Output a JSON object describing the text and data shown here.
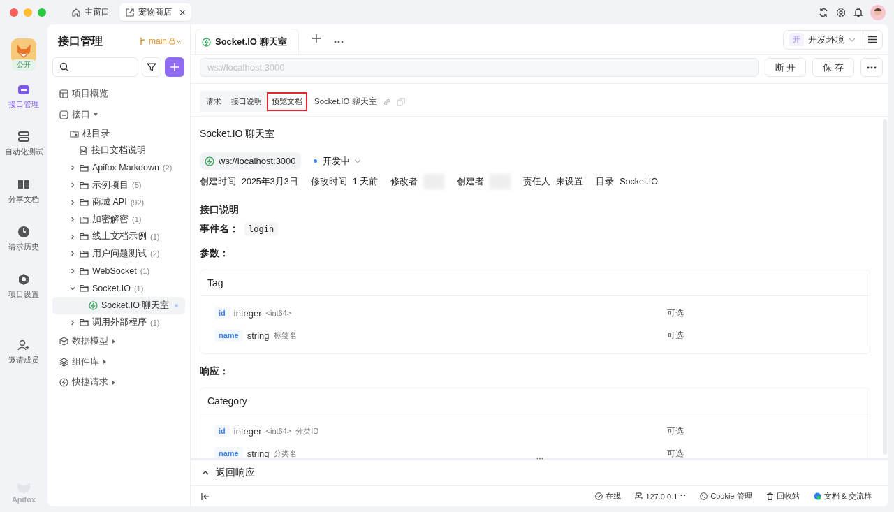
{
  "window": {
    "tabs": [
      {
        "label": "主窗口",
        "kind": "home",
        "selected": false
      },
      {
        "label": "宠物商店",
        "kind": "project",
        "selected": true,
        "closable": "×"
      }
    ]
  },
  "rail": {
    "badge": "公开",
    "items": [
      {
        "label": "接口管理",
        "kind": "api",
        "selected": true
      },
      {
        "label": "自动化测试",
        "kind": "autotest",
        "selected": false
      },
      {
        "label": "分享文档",
        "kind": "share",
        "selected": false
      },
      {
        "label": "请求历史",
        "kind": "history",
        "selected": false
      },
      {
        "label": "项目设置",
        "kind": "settings",
        "selected": false
      },
      {
        "label": "邀请成员",
        "kind": "invite",
        "selected": false
      }
    ],
    "brand": "Apifox"
  },
  "sidebar": {
    "title": "接口管理",
    "branch": "main",
    "nav": [
      {
        "label": "项目概览",
        "kind": "overview"
      },
      {
        "label": "接口",
        "kind": "api",
        "expanded": true,
        "children": [
          {
            "label": "根目录",
            "kind": "root",
            "children": [
              {
                "label": "接口文档说明",
                "kind": "doc"
              }
            ]
          },
          {
            "label": "Apifox Markdown",
            "count": "(2)",
            "kind": "folder",
            "expanded": false
          },
          {
            "label": "示例项目",
            "count": "(5)",
            "kind": "folder",
            "expanded": false
          },
          {
            "label": "商城 API",
            "count": "(92)",
            "kind": "folder",
            "expanded": false
          },
          {
            "label": "加密解密",
            "count": "(1)",
            "kind": "folder",
            "expanded": false
          },
          {
            "label": "线上文档示例",
            "count": "(1)",
            "kind": "folder",
            "expanded": false
          },
          {
            "label": "用户问题测试",
            "count": "(2)",
            "kind": "folder",
            "expanded": false
          },
          {
            "label": "WebSocket",
            "count": "(1)",
            "kind": "folder",
            "expanded": false
          },
          {
            "label": "Socket.IO",
            "count": "(1)",
            "kind": "folder",
            "expanded": true,
            "children": [
              {
                "label": "Socket.IO 聊天室",
                "kind": "socket",
                "selected": true
              }
            ]
          },
          {
            "label": "调用外部程序",
            "count": "(1)",
            "kind": "folder",
            "expanded": false
          }
        ]
      },
      {
        "label": "数据模型",
        "kind": "models",
        "expanded": false
      },
      {
        "label": "组件库",
        "kind": "components",
        "expanded": false
      },
      {
        "label": "快捷请求",
        "kind": "quick",
        "expanded": false
      }
    ]
  },
  "editor_tabs": [
    {
      "label": "Socket.IO 聊天室",
      "selected": true
    }
  ],
  "environment": {
    "badge": "开",
    "label": "开发环境"
  },
  "url_field": {
    "placeholder": "ws://localhost:3000"
  },
  "buttons": [
    {
      "label": "断 开"
    },
    {
      "label": "保 存"
    }
  ],
  "view_tabs": [
    {
      "label": "请求",
      "selected": false
    },
    {
      "label": "接口说明",
      "selected": false
    },
    {
      "label": "预览文档",
      "selected": true
    }
  ],
  "breadcrumb": "Socket.IO 聊天室",
  "doc": {
    "title": "Socket.IO 聊天室",
    "url": "ws://localhost:3000",
    "status": {
      "label": "开发中",
      "color": "#3b82f6"
    },
    "meta": [
      {
        "label": "创建时间",
        "value": "2025年3月3日"
      },
      {
        "label": "修改时间",
        "value": "1 天前"
      },
      {
        "label": "修改者",
        "redacted": true
      },
      {
        "label": "创建者",
        "redacted": true
      },
      {
        "label": "责任人",
        "value": "未设置"
      },
      {
        "label": "目录",
        "value": "Socket.IO"
      }
    ],
    "section": "接口说明",
    "event_label": "事件名：",
    "event": "login",
    "params_label": "参数：",
    "params": {
      "name": "Tag",
      "fields": [
        {
          "name": "id",
          "type": "integer",
          "format": "<int64>",
          "required": "可选"
        },
        {
          "name": "name",
          "type": "string",
          "desc": "标签名",
          "required": "可选"
        }
      ]
    },
    "response_label": "响应：",
    "response": {
      "name": "Category",
      "fields": [
        {
          "name": "id",
          "type": "integer",
          "format": "<int64>",
          "desc": "分类ID",
          "required": "可选"
        },
        {
          "name": "name",
          "type": "string",
          "desc": "分类名",
          "required": "可选"
        }
      ]
    }
  },
  "response_panel": {
    "title": "返回响应",
    "expanded": false
  },
  "status_bar": [
    {
      "label": "在线",
      "kind": "online"
    },
    {
      "label": "127.0.0.1",
      "kind": "proxy"
    },
    {
      "label": "Cookie 管理",
      "kind": "cookie"
    },
    {
      "label": "回收站",
      "kind": "trash"
    },
    {
      "label": "文档 & 交流群",
      "kind": "chat"
    }
  ]
}
